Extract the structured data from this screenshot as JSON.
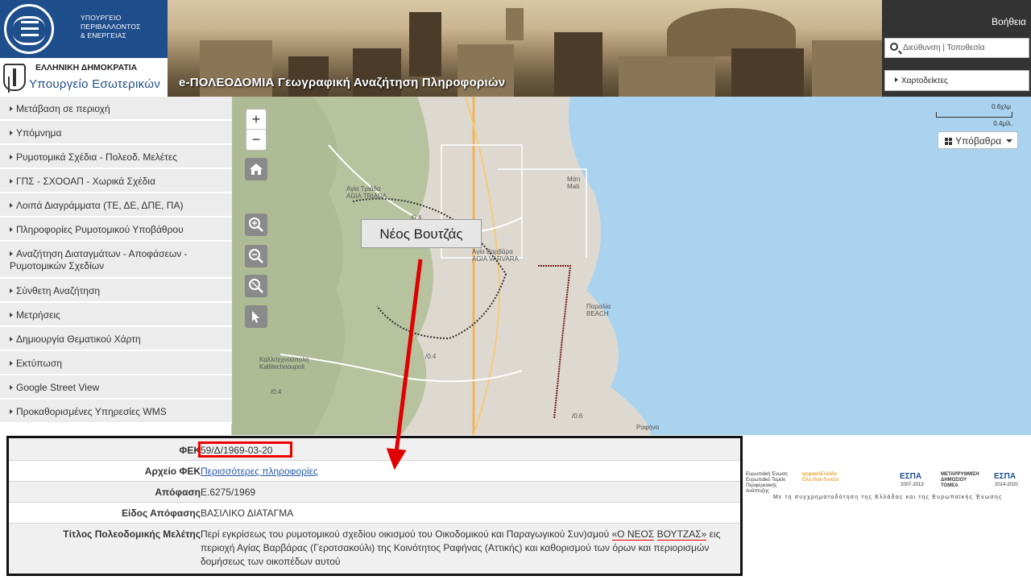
{
  "header": {
    "env_ministry_line1": "ΥΠΟΥΡΓΕΙΟ",
    "env_ministry_line2": "ΠΕΡΙΒΑΛΛΟΝΤΟΣ",
    "env_ministry_line3": "& ΕΝΕΡΓΕΙΑΣ",
    "republic": "ΕΛΛΗΝΙΚΗ ΔΗΜΟΚΡΑΤΙΑ",
    "interior_ministry": "Υπουργείο Εσωτερικών",
    "title": "e-ΠΟΛΕΟΔΟΜΙΑ Γεωγραφική Αναζήτηση Πληροφοριών",
    "help": "Βοήθεια",
    "search_placeholder": "Διεύθυνση | Τοποθεσία",
    "charts_button": "Χαρτοδείκτες"
  },
  "sidebar": {
    "items": [
      "Μετάβαση σε περιοχή",
      "Υπόμνημα",
      "Ρυμοτομικά Σχέδια - Πολεοδ. Μελέτες",
      "ΓΠΣ - ΣΧΟΟΑΠ - Χωρικά Σχέδια",
      "Λοιπά Διαγράμματα (ΤΕ, ΔΕ, ΔΠΕ, ΠΑ)",
      "Πληροφορίες Ρυμοτομικού Υποβάθρου",
      "Αναζήτηση Διαταγμάτων - Αποφάσεων - Ρυμοτομικών Σχεδίων",
      "Σύνθετη Αναζήτηση",
      "Μετρήσεις",
      "Δημιουργία Θεματικού Χάρτη",
      "Εκτύπωση",
      "Google Street View",
      "Προκαθορισμένες Υπηρεσίες WMS"
    ]
  },
  "map": {
    "zoom_in": "+",
    "zoom_out": "−",
    "scale_km": "0.6χλμ",
    "scale_mi": "0.4μίλ.",
    "basemap_button": "Υπόβαθρα",
    "callout": "Νέος Βουτζάς",
    "labels": {
      "agia_triada": "Αγία Τριάδα\nAGIA TRIADA",
      "agia_varvara": "Αγία Βαρβάρα\nAGIA VARVARA",
      "mati": "Μάτι\nMati",
      "paralia": "Παραλία\nBEACH",
      "kallitechnoupoli": "Καλλιτεχνούπολη\nKallitechnoupoli",
      "rafina": "Ραφήνα",
      "v04a": "/0.4",
      "v04b": "/0.4",
      "v04c": "/0.4",
      "v06": "/0.6"
    }
  },
  "footer": {
    "eu": "Ευρωπαϊκή Ένωση\nΕυρωπαϊκό Ταμείο\nΠεριφερειακής\nΑνάπτυξης",
    "digital": "ψηφιακήΕλλάδα\nΌλα είναι δυνατά",
    "espa1": "ΕΣΠΑ",
    "espa1_years": "2007-2013",
    "reform": "ΜΕΤΑΡΡΥΘΜΙΣΗ\nΔΗΜΟΣΙΟΥ\nΤΟΜΕΑ",
    "espa2": "ΕΣΠΑ",
    "espa2_years": "2014-2020",
    "cofinance": "Με τη συγχρηματοδότηση της Ελλάδας και της Ευρωπαϊκής Ένωσης"
  },
  "info": {
    "fek_label": "ΦΕΚ",
    "fek_value": "59/Δ/1969-03-20",
    "archive_label": "Αρχείο ΦΕΚ",
    "archive_value": "Περισσότερες πληροφορίες",
    "decision_label": "Απόφαση",
    "decision_value": "Ε.6275/1969",
    "decision_type_label": "Είδος Απόφασης",
    "decision_type_value": "ΒΑΣΙΛΙΚΟ ΔΙΑΤΑΓΜΑ",
    "study_title_label": "Τίτλος Πολεοδομικής Μελέτης",
    "study_title_part1": "Περί εγκρίσεως του ρυμοτομικού σχεδίου οικισμού του Οικοδομικού και Παραγωγικού Συν)σμού ",
    "study_title_highlight_a": "«Ο ΝΕΟΣ",
    "study_title_highlight_b": "ΒΟΥΤΖΑΣ»",
    "study_title_part2": " εις περιοχή Αγίας Βαρβάρας (Γεροτσακούλι) της Κοινότητος Ραφήνας (Αττικής) και καθορισμού των όρων και περιορισμών δομήσεως των οικοπέδων αυτού"
  },
  "colors": {
    "env_blue": "#1f4e8c",
    "sea": "#a9d3ef",
    "forest": "#b7c29e",
    "annotation_red": "#e00000"
  }
}
